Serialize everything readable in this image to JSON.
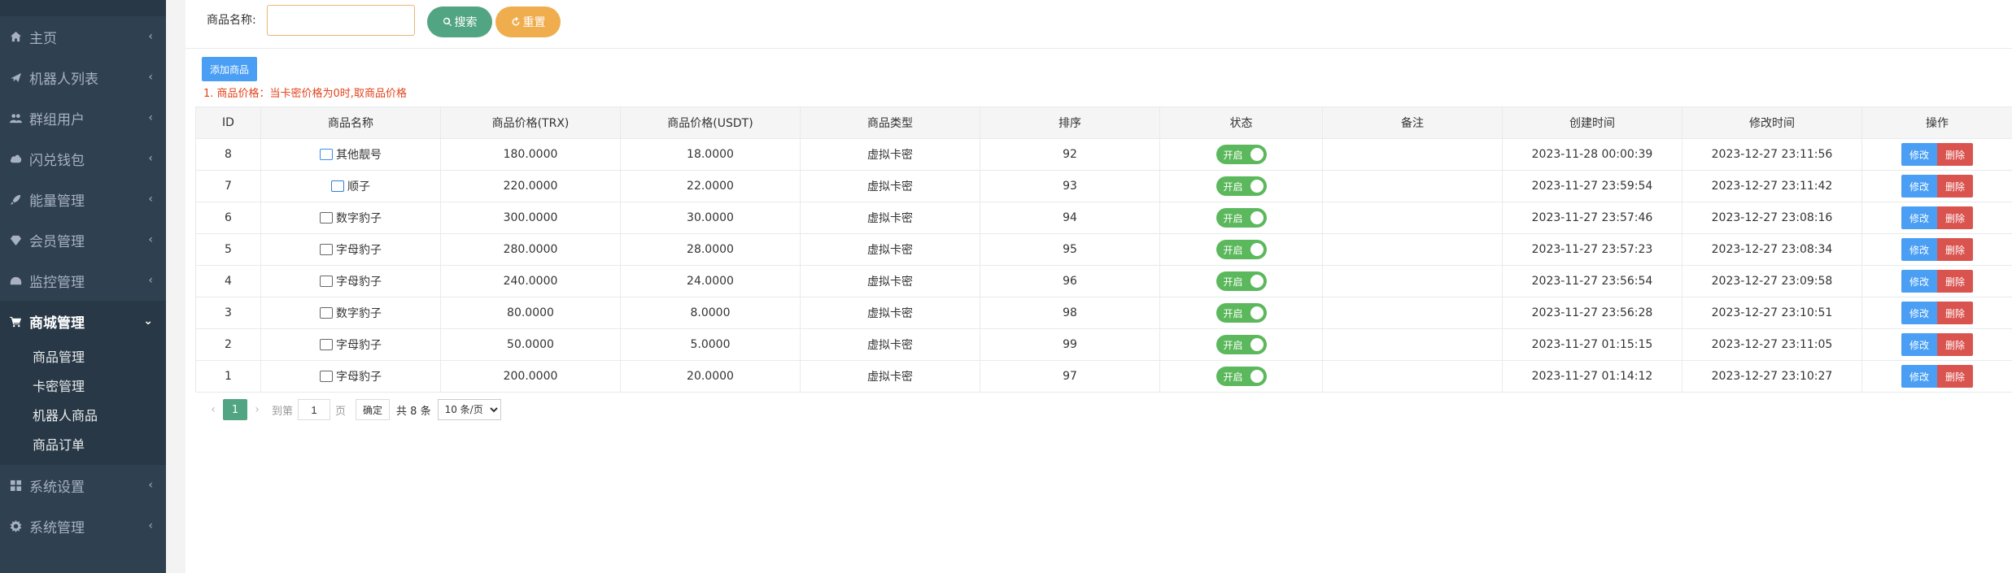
{
  "sidebar": {
    "items": [
      {
        "label": "主页",
        "icon": "home-icon"
      },
      {
        "label": "机器人列表",
        "icon": "plane-icon"
      },
      {
        "label": "群组用户",
        "icon": "users-icon"
      },
      {
        "label": "闪兑钱包",
        "icon": "cloud-download-icon"
      },
      {
        "label": "能量管理",
        "icon": "rocket-icon"
      },
      {
        "label": "会员管理",
        "icon": "diamond-icon"
      },
      {
        "label": "监控管理",
        "icon": "tachometer-icon"
      },
      {
        "label": "商城管理",
        "icon": "cart-icon",
        "active": true
      },
      {
        "label": "系统设置",
        "icon": "windows-icon"
      },
      {
        "label": "系统管理",
        "icon": "gear-icon"
      }
    ],
    "sub_items": [
      "商品管理",
      "卡密管理",
      "机器人商品",
      "商品订单"
    ]
  },
  "search": {
    "label": "商品名称:",
    "value": "",
    "search_label": "搜索",
    "reset_label": "重置"
  },
  "toolbar": {
    "add_label": "添加商品",
    "note": "1. 商品价格：当卡密价格为0时,取商品价格"
  },
  "table": {
    "headers": [
      "ID",
      "商品名称",
      "商品价格(TRX)",
      "商品价格(USDT)",
      "商品类型",
      "排序",
      "状态",
      "备注",
      "创建时间",
      "修改时间",
      "操作"
    ],
    "rows": [
      {
        "id": "8",
        "name": "其他靓号",
        "trx": "180.0000",
        "usdt": "18.0000",
        "type": "虚拟卡密",
        "sort": "92",
        "status": "开启",
        "remark": "",
        "created": "2023-11-28 00:00:39",
        "modified": "2023-12-27 23:11:56",
        "edit": "修改",
        "del": "删除",
        "pic_color": "#3a8ee6"
      },
      {
        "id": "7",
        "name": "顺子",
        "trx": "220.0000",
        "usdt": "22.0000",
        "type": "虚拟卡密",
        "sort": "93",
        "status": "开启",
        "remark": "",
        "created": "2023-11-27 23:59:54",
        "modified": "2023-12-27 23:11:42",
        "edit": "修改",
        "del": "删除",
        "pic_color": "#2d7fd8"
      },
      {
        "id": "6",
        "name": "数字豹子",
        "trx": "300.0000",
        "usdt": "30.0000",
        "type": "虚拟卡密",
        "sort": "94",
        "status": "开启",
        "remark": "",
        "created": "2023-11-27 23:57:46",
        "modified": "2023-12-27 23:08:16",
        "edit": "修改",
        "del": "删除",
        "pic_color": "#666666"
      },
      {
        "id": "5",
        "name": "字母豹子",
        "trx": "280.0000",
        "usdt": "28.0000",
        "type": "虚拟卡密",
        "sort": "95",
        "status": "开启",
        "remark": "",
        "created": "2023-11-27 23:57:23",
        "modified": "2023-12-27 23:08:34",
        "edit": "修改",
        "del": "删除",
        "pic_color": "#666666"
      },
      {
        "id": "4",
        "name": "字母豹子",
        "trx": "240.0000",
        "usdt": "24.0000",
        "type": "虚拟卡密",
        "sort": "96",
        "status": "开启",
        "remark": "",
        "created": "2023-11-27 23:56:54",
        "modified": "2023-12-27 23:09:58",
        "edit": "修改",
        "del": "删除",
        "pic_color": "#666666"
      },
      {
        "id": "3",
        "name": "数字豹子",
        "trx": "80.0000",
        "usdt": "8.0000",
        "type": "虚拟卡密",
        "sort": "98",
        "status": "开启",
        "remark": "",
        "created": "2023-11-27 23:56:28",
        "modified": "2023-12-27 23:10:51",
        "edit": "修改",
        "del": "删除",
        "pic_color": "#666666"
      },
      {
        "id": "2",
        "name": "字母豹子",
        "trx": "50.0000",
        "usdt": "5.0000",
        "type": "虚拟卡密",
        "sort": "99",
        "status": "开启",
        "remark": "",
        "created": "2023-11-27 01:15:15",
        "modified": "2023-12-27 23:11:05",
        "edit": "修改",
        "del": "删除",
        "pic_color": "#666666"
      },
      {
        "id": "1",
        "name": "字母豹子",
        "trx": "200.0000",
        "usdt": "20.0000",
        "type": "虚拟卡密",
        "sort": "97",
        "status": "开启",
        "remark": "",
        "created": "2023-11-27 01:14:12",
        "modified": "2023-12-27 23:10:27",
        "edit": "修改",
        "del": "删除",
        "pic_color": "#666666"
      }
    ]
  },
  "pagination": {
    "current": "1",
    "goto_label": "到第",
    "goto_value": "1",
    "page_label": "页",
    "confirm_label": "确定",
    "total_label": "共 8 条",
    "page_size": "10 条/页"
  },
  "colors": {
    "sidebar_bg": "#2f4050",
    "accent_green": "#52a582",
    "accent_orange": "#f0ad4e",
    "primary_blue": "#4a9ff5",
    "danger_red": "#d9534f",
    "toggle_green": "#5cb85c"
  }
}
